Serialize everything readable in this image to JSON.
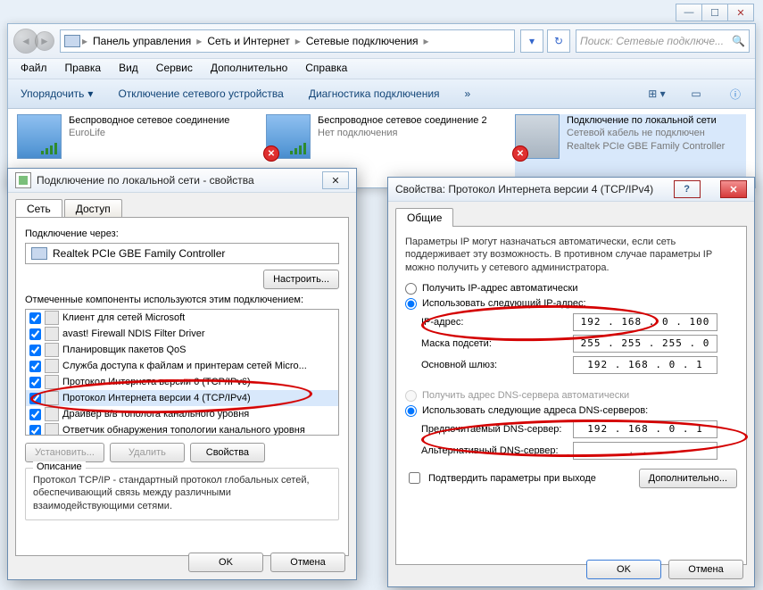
{
  "explorer": {
    "breadcrumb": [
      "Панель управления",
      "Сеть и Интернет",
      "Сетевые подключения"
    ],
    "search_placeholder": "Поиск: Сетевые подключе...",
    "menus": [
      "Файл",
      "Правка",
      "Вид",
      "Сервис",
      "Дополнительно",
      "Справка"
    ],
    "toolbar": {
      "organize": "Упорядочить",
      "disable": "Отключение сетевого устройства",
      "diagnose": "Диагностика подключения"
    },
    "connections": [
      {
        "name": "Беспроводное сетевое соединение",
        "status": "EuroLife",
        "type": "wifi",
        "disconnected": false
      },
      {
        "name": "Беспроводное сетевое соединение 2",
        "status": "Нет подключения",
        "type": "wifi",
        "disconnected": true
      },
      {
        "name": "Подключение по локальной сети",
        "status": "Сетевой кабель не подключен",
        "detail": "Realtek PCIe GBE Family Controller",
        "type": "lan",
        "disconnected": true,
        "selected": true
      }
    ]
  },
  "props": {
    "title": "Подключение по локальной сети - свойства",
    "tabs": [
      "Сеть",
      "Доступ"
    ],
    "connect_using_label": "Подключение через:",
    "adapter": "Realtek PCIe GBE Family Controller",
    "configure_btn": "Настроить...",
    "components_label": "Отмеченные компоненты используются этим подключением:",
    "components": [
      "Клиент для сетей Microsoft",
      "avast! Firewall NDIS Filter Driver",
      "Планировщик пакетов QoS",
      "Служба доступа к файлам и принтерам сетей Micro...",
      "Протокол Интернета версии 6 (TCP/IPv6)",
      "Протокол Интернета версии 4 (TCP/IPv4)",
      "Драйвер в/в тополога канального уровня",
      "Ответчик обнаружения топологии канального уровня"
    ],
    "install_btn": "Установить...",
    "uninstall_btn": "Удалить",
    "properties_btn": "Свойства",
    "description_title": "Описание",
    "description": "Протокол TCP/IP - стандартный протокол глобальных сетей, обеспечивающий связь между различными взаимодействующими сетями.",
    "ok": "OK",
    "cancel": "Отмена"
  },
  "ipv4": {
    "title": "Свойства: Протокол Интернета версии 4 (TCP/IPv4)",
    "tab": "Общие",
    "intro": "Параметры IP могут назначаться автоматически, если сеть поддерживает эту возможность. В противном случае параметры IP можно получить у сетевого администратора.",
    "radio_auto_ip": "Получить IP-адрес автоматически",
    "radio_static_ip": "Использовать следующий IP-адрес:",
    "ip_label": "IP-адрес:",
    "ip_value": "192 . 168 .  0  . 100",
    "mask_label": "Маска подсети:",
    "mask_value": "255 . 255 . 255 .  0",
    "gw_label": "Основной шлюз:",
    "gw_value": "192 . 168 .  0  .  1",
    "radio_auto_dns": "Получить адрес DNS-сервера автоматически",
    "radio_static_dns": "Использовать следующие адреса DNS-серверов:",
    "dns1_label": "Предпочитаемый DNS-сервер:",
    "dns1_value": "192 . 168 .  0  .  1",
    "dns2_label": "Альтернативный DNS-сервер:",
    "dns2_value": " .       .       .  ",
    "confirm_exit": "Подтвердить параметры при выходе",
    "advanced_btn": "Дополнительно...",
    "ok": "OK",
    "cancel": "Отмена"
  }
}
